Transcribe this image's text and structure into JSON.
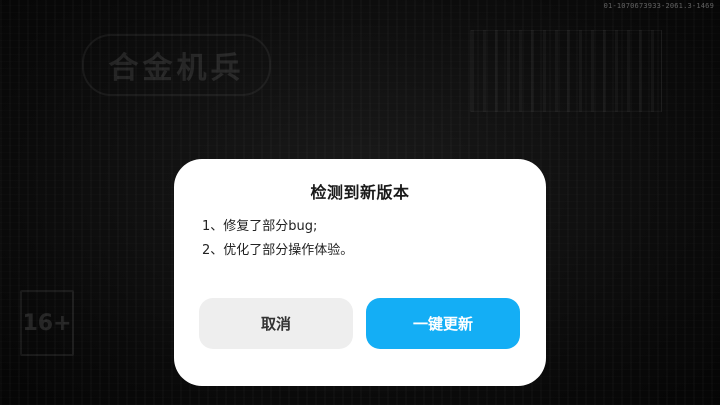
{
  "background": {
    "logo_text": "合金机兵",
    "age_badge": "16+",
    "version": "01-1070673933-2061.3-1469"
  },
  "dialog": {
    "title": "检测到新版本",
    "notes": [
      "1、修复了部分bug;",
      "2、优化了部分操作体验。"
    ],
    "cancel_label": "取消",
    "update_label": "一键更新"
  },
  "colors": {
    "accent": "#14aef5",
    "cancel_bg": "#eeeeee",
    "dialog_bg": "#ffffff",
    "overlay_bg": "#0c0c0c"
  }
}
